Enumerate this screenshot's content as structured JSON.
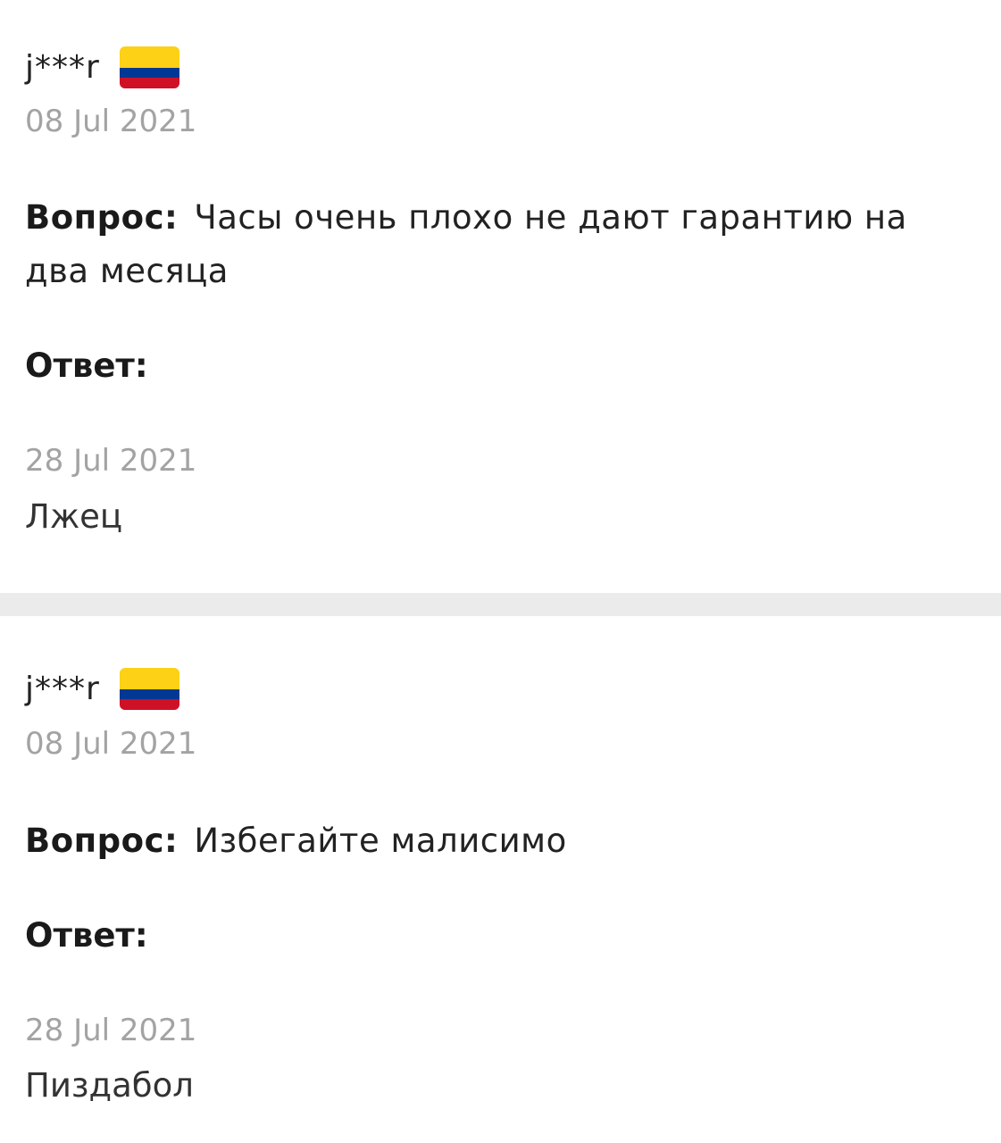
{
  "flag_colors": {
    "yellow": "#fcd116",
    "blue": "#003893",
    "red": "#ce1126"
  },
  "items": [
    {
      "username": "j***r",
      "flag_icon": "colombia-flag-icon",
      "question_date": "08 Jul 2021",
      "question_label": "Вопрос",
      "question_colon": ":",
      "question_text": "Часы очень плохо не дают гарантию на два месяца",
      "answer_label": "Ответ:",
      "answer_date": "28 Jul 2021",
      "answer_text": "Лжец"
    },
    {
      "username": "j***r",
      "flag_icon": "colombia-flag-icon",
      "question_date": "08 Jul 2021",
      "question_label": "Вопрос",
      "question_colon": ":",
      "question_text": "Избегайте малисимо",
      "answer_label": "Ответ:",
      "answer_date": "28 Jul 2021",
      "answer_text": "Пиздабол"
    }
  ]
}
